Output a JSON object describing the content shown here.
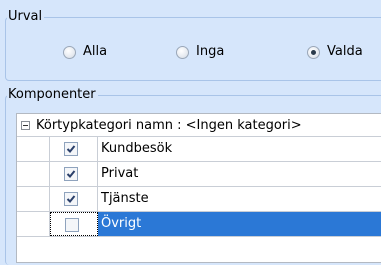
{
  "urval": {
    "title": "Urval",
    "options": [
      {
        "label": "Alla",
        "checked": false
      },
      {
        "label": "Inga",
        "checked": false
      },
      {
        "label": "Valda",
        "checked": true
      }
    ]
  },
  "komponenter": {
    "title": "Komponenter",
    "group_header": "Körtypkategori namn : <Ingen kategori>",
    "rows": [
      {
        "name": "Kundbesök",
        "checked": true,
        "selected": false
      },
      {
        "name": "Privat",
        "checked": true,
        "selected": false
      },
      {
        "name": "Tjänste",
        "checked": true,
        "selected": false
      },
      {
        "name": "Övrigt",
        "checked": false,
        "selected": true
      }
    ]
  },
  "colors": {
    "background": "#d6e6fb",
    "selection": "#2b78d6"
  }
}
